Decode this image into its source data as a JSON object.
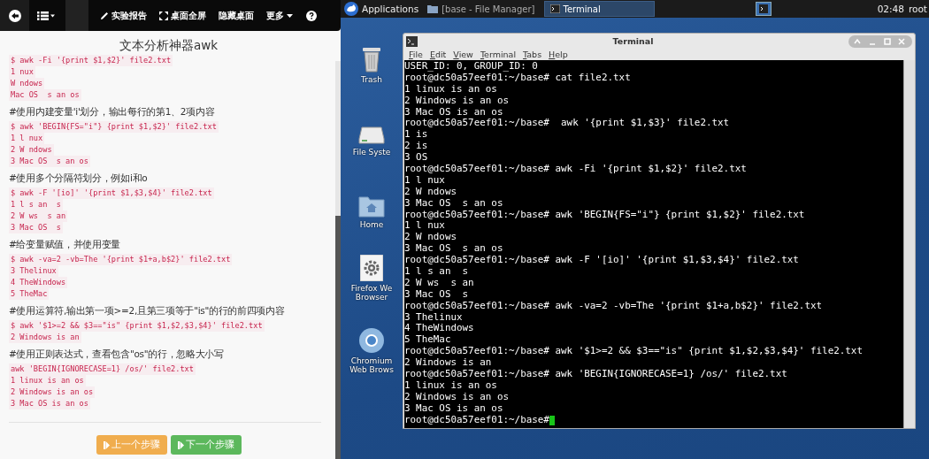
{
  "toolbar": {
    "items": [
      {
        "kind": "back"
      },
      {
        "kind": "list-menu"
      },
      {
        "kind": "blank"
      },
      {
        "kind": "report",
        "label": "实验报告"
      },
      {
        "kind": "fullscreen",
        "label": "桌面全屏"
      },
      {
        "kind": "hide",
        "label": "隐藏桌面"
      },
      {
        "kind": "more",
        "label": "更多"
      },
      {
        "kind": "help"
      }
    ]
  },
  "lesson": {
    "title": "文本分析神器awk",
    "blocks": [
      {
        "code": [
          "$ awk -Fi '{print $1,$2}' file2.txt",
          "1 nux",
          "W ndows",
          "Mac OS  s an os"
        ]
      },
      {
        "heading": "#使用内建变量'i'划分，输出每行的第1、2项内容",
        "code": [
          "$ awk 'BEGIN{FS=\"i\"} {print $1,$2}' file2.txt",
          "1 l nux",
          "2 W ndows",
          "3 Mac OS  s an os"
        ]
      },
      {
        "heading": "#使用多个分隔符划分，例如i和o",
        "code": [
          "$ awk -F '[io]' '{print $1,$3,$4}' file2.txt",
          "1 l s an  s",
          "2 W ws  s an",
          "3 Mac OS  s"
        ]
      },
      {
        "heading": "#给变量赋值，并使用变量",
        "code": [
          "$ awk -va=2 -vb=The '{print $1+a,b$2}' file2.txt",
          "3 Thelinux",
          "4 TheWindows",
          "5 TheMac"
        ]
      },
      {
        "heading": "#使用运算符,输出第一项>=2,且第三项等于\"is\"的行的前四项内容",
        "code": [
          "$ awk '$1>=2 && $3==\"is\" {print $1,$2,$3,$4}' file2.txt",
          "2 Windows is an"
        ]
      },
      {
        "heading": "#使用正则表达式，查看包含\"os\"的行，忽略大小写",
        "code": [
          "awk 'BEGIN{IGNORECASE=1} /os/' file2.txt",
          "1 linux is an os",
          "2 Windows is an os",
          "3 Mac OS is an os"
        ]
      }
    ],
    "buttons": [
      {
        "kind": "prev",
        "label": "上一个步骤"
      },
      {
        "kind": "next",
        "label": "下一个步骤"
      }
    ]
  },
  "taskbar": {
    "menu": "Applications",
    "tasks": [
      {
        "kind": "folder",
        "label": "[base - File Manager]",
        "selected": false
      },
      {
        "kind": "terminal",
        "label": "Terminal",
        "selected": true
      }
    ],
    "clock": "02:48",
    "user": "root"
  },
  "desktop_icons": [
    {
      "kind": "trash",
      "lines": [
        "Trash"
      ]
    },
    {
      "kind": "drive",
      "lines": [
        "File Syste"
      ]
    },
    {
      "kind": "home",
      "lines": [
        "Home"
      ]
    },
    {
      "kind": "gear",
      "lines": [
        "Firefox We",
        "Browser"
      ]
    },
    {
      "kind": "globe",
      "lines": [
        "Chromium",
        "Web Brows"
      ]
    }
  ],
  "terminal": {
    "title": "Terminal",
    "menu": [
      "File",
      "Edit",
      "View",
      "Terminal",
      "Tabs",
      "Help"
    ],
    "lines": [
      "USER_ID: 0, GROUP_ID: 0",
      "root@dc50a57eef01:~/base# cat file2.txt",
      "1 linux is an os",
      "2 Windows is an os",
      "3 Mac OS is an os",
      "root@dc50a57eef01:~/base#  awk '{print $1,$3}' file2.txt",
      "1 is",
      "2 is",
      "3 OS",
      "root@dc50a57eef01:~/base# awk -Fi '{print $1,$2}' file2.txt",
      "1 l nux",
      "2 W ndows",
      "3 Mac OS  s an os",
      "root@dc50a57eef01:~/base# awk 'BEGIN{FS=\"i\"} {print $1,$2}' file2.txt",
      "1 l nux",
      "2 W ndows",
      "3 Mac OS  s an os",
      "root@dc50a57eef01:~/base# awk -F '[io]' '{print $1,$3,$4}' file2.txt",
      "1 l s an  s",
      "2 W ws  s an",
      "3 Mac OS  s",
      "root@dc50a57eef01:~/base# awk -va=2 -vb=The '{print $1+a,b$2}' file2.txt",
      "3 Thelinux",
      "4 TheWindows",
      "5 TheMac",
      "root@dc50a57eef01:~/base# awk '$1>=2 && $3==\"is\" {print $1,$2,$3,$4}' file2.txt",
      "2 Windows is an",
      "root@dc50a57eef01:~/base# awk 'BEGIN{IGNORECASE=1} /os/' file2.txt",
      "1 linux is an os",
      "2 Windows is an os",
      "3 Mac OS is an os"
    ],
    "prompt": "root@dc50a57eef01:~/base#"
  }
}
